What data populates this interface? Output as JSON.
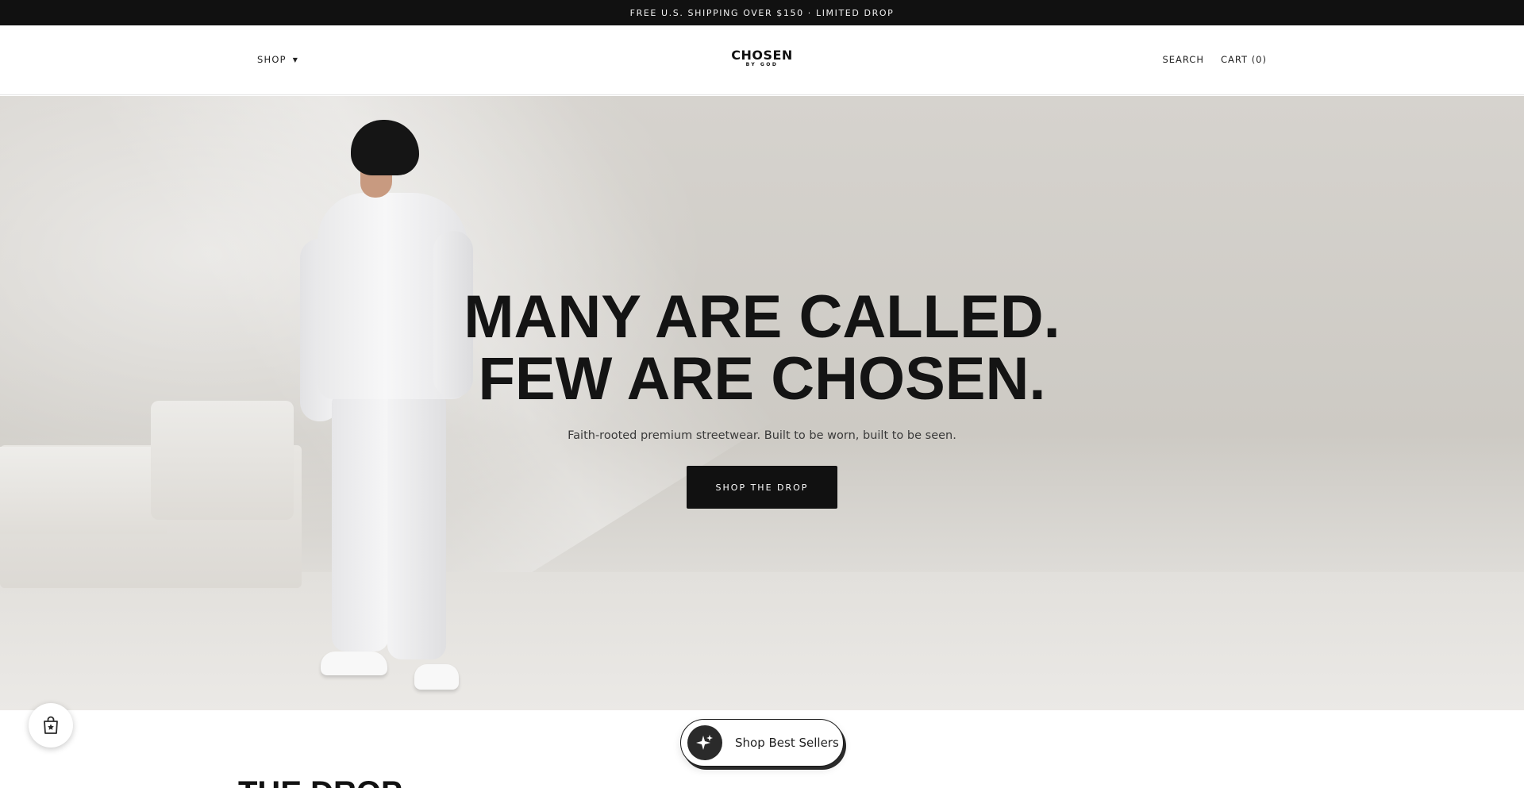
{
  "announcement": {
    "text": "FREE U.S. SHIPPING OVER $150 · LIMITED DROP"
  },
  "header": {
    "shop_label": "SHOP",
    "logo_main": "CHOSEN",
    "logo_sub": "BY GOD",
    "search_label": "SEARCH",
    "cart_label": "CART (0)"
  },
  "hero": {
    "headline_line1": "MANY ARE CALLED.",
    "headline_line2": "FEW ARE CHOSEN.",
    "subheadline": "Faith-rooted premium streetwear. Built to be worn, built to be seen.",
    "cta_label": "SHOP THE DROP"
  },
  "section": {
    "title": "THE DROP"
  },
  "floating": {
    "best_sellers_label": "Shop Best Sellers"
  },
  "icons": {
    "caret": "chevron-down-icon",
    "reward": "shopping-bag-star-icon",
    "sparkle": "sparkle-icon"
  },
  "colors": {
    "accent": "#111111",
    "announcement_bg": "#111111",
    "hero_bg": "#d3d0cb"
  }
}
